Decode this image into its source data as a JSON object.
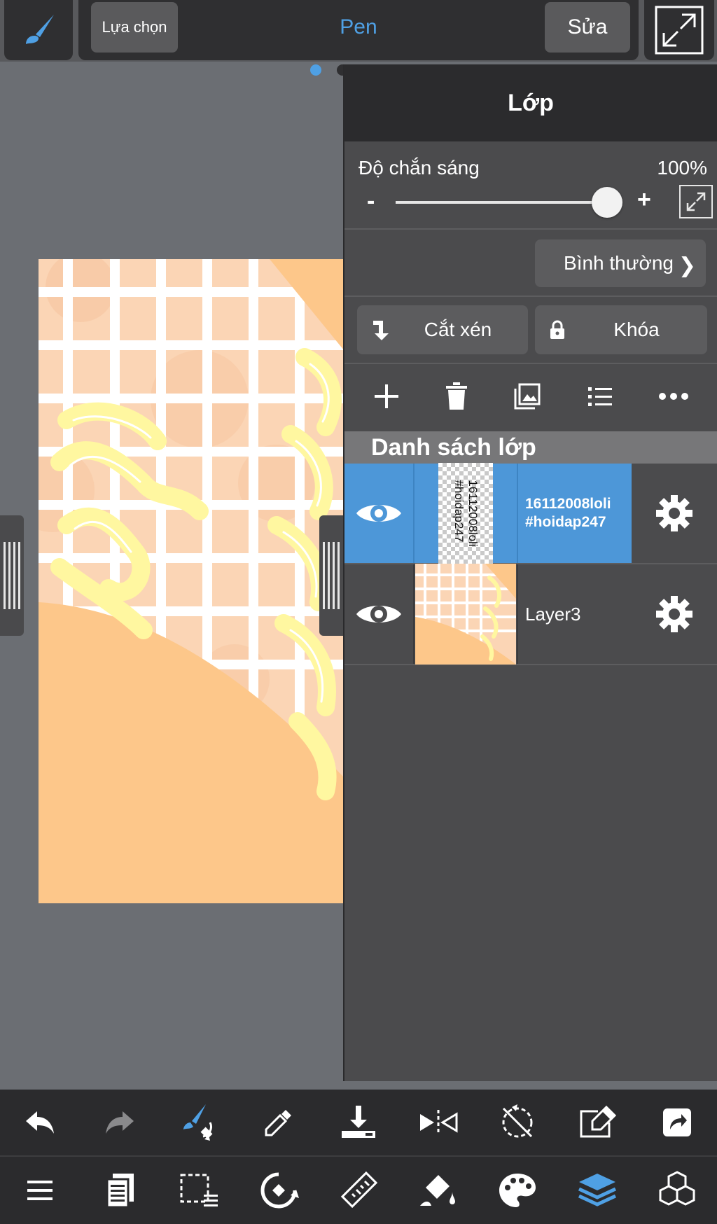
{
  "top_bar": {
    "select_label": "Lựa chọn",
    "tool_name": "Pen",
    "edit_label": "Sửa"
  },
  "colors": {
    "accent": "#4fa0e4",
    "selected_layer": "#4d97d8",
    "panel": "#4b4b4d",
    "canvas_background": "#6b6e73",
    "toolbar": "#2b2b2d"
  },
  "layer_panel": {
    "title": "Lớp",
    "opacity_label": "Độ chắn sáng",
    "opacity_value": "100%",
    "opacity_minus": "-",
    "opacity_plus": "+",
    "opacity_level": 1.0,
    "blend_mode": "Bình thường",
    "clip_label": "Cắt xén",
    "lock_label": "Khóa",
    "actions": [
      "add-icon",
      "trash-icon",
      "image-layer-icon",
      "list-icon",
      "more-icon"
    ],
    "list_title": "Danh sách lớp",
    "layers": [
      {
        "name_line1": "16112008loli",
        "name_line2": "#hoidap247",
        "thumb_line1": "16112008loli",
        "thumb_line2": "#hoidap247",
        "selected": true,
        "visible": true
      },
      {
        "name": "Layer3",
        "selected": false,
        "visible": true
      }
    ]
  },
  "bottom_toolbar": {
    "row1": [
      "undo-icon",
      "redo-icon",
      "brush-swap-icon",
      "eyedropper-icon",
      "import-icon",
      "flip-icon",
      "rotate-reset-icon",
      "edit-canvas-icon",
      "share-icon"
    ],
    "row2": [
      "menu-icon",
      "pages-icon",
      "selection-icon",
      "transform-icon",
      "ruler-icon",
      "fill-icon",
      "palette-icon",
      "layers-icon",
      "materials-icon"
    ]
  }
}
